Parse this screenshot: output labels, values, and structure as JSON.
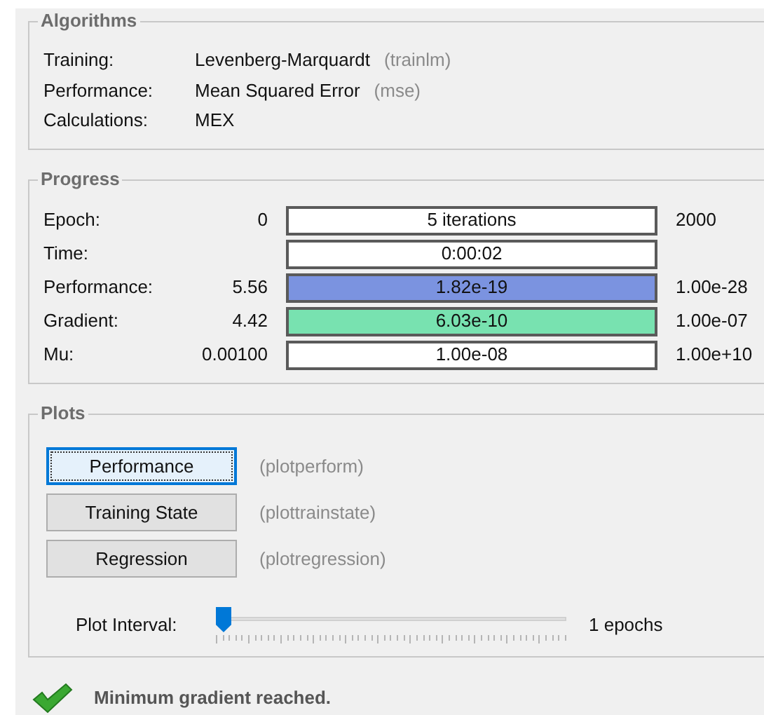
{
  "algorithms": {
    "title": "Algorithms",
    "rows": [
      {
        "label": "Training:",
        "value": "Levenberg-Marquardt",
        "hint": "(trainlm)"
      },
      {
        "label": "Performance:",
        "value": "Mean Squared Error",
        "hint": "(mse)"
      },
      {
        "label": "Calculations:",
        "value": "MEX"
      }
    ]
  },
  "progress": {
    "title": "Progress",
    "rows": [
      {
        "label": "Epoch:",
        "start": "0",
        "bar_text": "5 iterations",
        "level": 0,
        "end": "2000"
      },
      {
        "label": "Time:",
        "bar_text": "0:00:02",
        "level": 0
      },
      {
        "label": "Performance:",
        "start": "5.56",
        "bar_text": "1.82e-19",
        "level": 1,
        "color": "#7b93e0",
        "end": "1.00e-28"
      },
      {
        "label": "Gradient:",
        "start": "4.42",
        "bar_text": "6.03e-10",
        "level": 1,
        "color": "#78e2b0",
        "end": "1.00e-07"
      },
      {
        "label": "Mu:",
        "start": "0.00100",
        "bar_text": "1.00e-08",
        "level": 0,
        "end": "1.00e+10"
      }
    ]
  },
  "plots": {
    "title": "Plots",
    "buttons": [
      {
        "label": "Performance",
        "hint": "(plotperform)",
        "focused": true
      },
      {
        "label": "Training State",
        "hint": "(plottrainstate)",
        "focused": false
      },
      {
        "label": "Regression",
        "hint": "(plotregression)",
        "focused": false
      }
    ],
    "interval": {
      "label": "Plot Interval:",
      "level": 0,
      "reading": "1 epochs"
    }
  },
  "status": {
    "message": "Minimum gradient reached."
  }
}
